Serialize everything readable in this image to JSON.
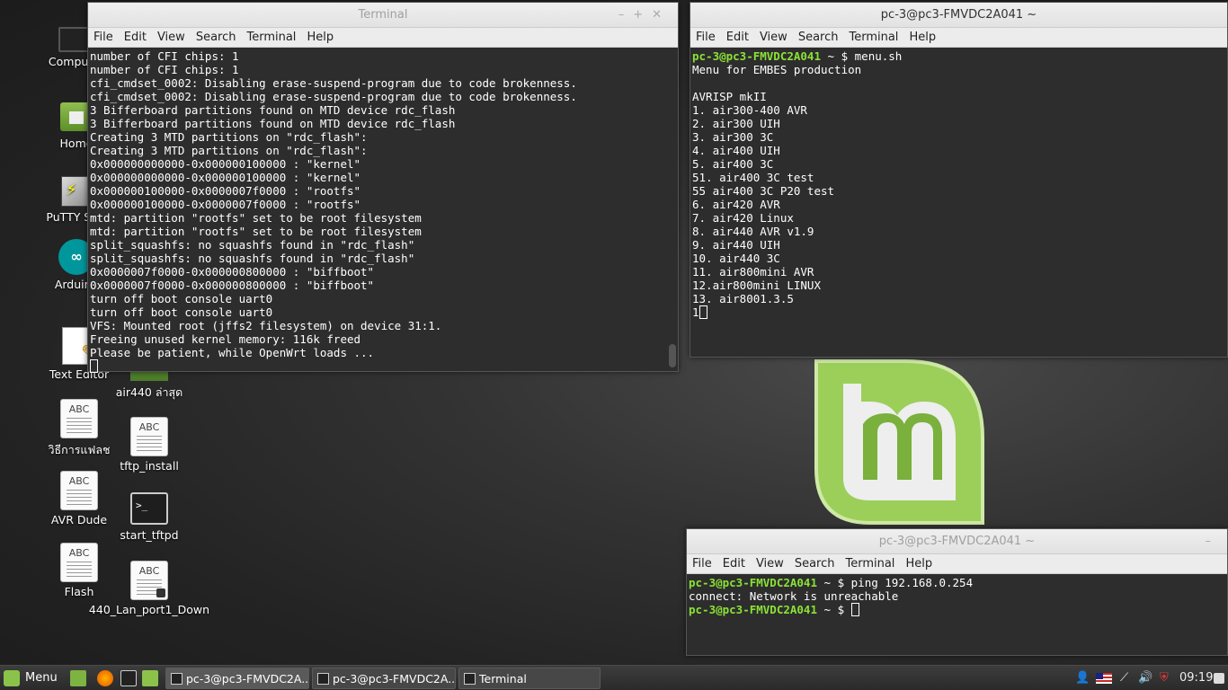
{
  "desktop": {
    "icons": [
      {
        "name": "computer",
        "label": "Computer"
      },
      {
        "name": "home",
        "label": "Home"
      },
      {
        "name": "putty",
        "label": "PuTTY SSH"
      },
      {
        "name": "arduino",
        "label": "Arduino"
      },
      {
        "name": "text-editor",
        "label": "Text Editor"
      },
      {
        "name": "air440",
        "label": "air440 ล่าสุด"
      },
      {
        "name": "flash-howto",
        "label": "วิธีการแฟลช"
      },
      {
        "name": "tftp-install",
        "label": "tftp_install"
      },
      {
        "name": "avr-dude",
        "label": "AVR Dude"
      },
      {
        "name": "start-tftpd",
        "label": "start_tftpd"
      },
      {
        "name": "flash",
        "label": "Flash"
      },
      {
        "name": "lan-port",
        "label": "440_Lan_port1_Down"
      }
    ],
    "doc_badge": "ABC",
    "term_badge": ">_",
    "arduino_badge": "∞"
  },
  "menu_labels": {
    "file": "File",
    "edit": "Edit",
    "view": "View",
    "search": "Search",
    "terminal": "Terminal",
    "help": "Help"
  },
  "win1": {
    "title": "Terminal",
    "lines": [
      "number of CFI chips: 1",
      "number of CFI chips: 1",
      "cfi_cmdset_0002: Disabling erase-suspend-program due to code brokenness.",
      "cfi_cmdset_0002: Disabling erase-suspend-program due to code brokenness.",
      "3 Bifferboard partitions found on MTD device rdc_flash",
      "3 Bifferboard partitions found on MTD device rdc_flash",
      "Creating 3 MTD partitions on \"rdc_flash\":",
      "Creating 3 MTD partitions on \"rdc_flash\":",
      "0x000000000000-0x000000100000 : \"kernel\"",
      "0x000000000000-0x000000100000 : \"kernel\"",
      "0x000000100000-0x0000007f0000 : \"rootfs\"",
      "0x000000100000-0x0000007f0000 : \"rootfs\"",
      "mtd: partition \"rootfs\" set to be root filesystem",
      "mtd: partition \"rootfs\" set to be root filesystem",
      "split_squashfs: no squashfs found in \"rdc_flash\"",
      "split_squashfs: no squashfs found in \"rdc_flash\"",
      "0x0000007f0000-0x000000800000 : \"biffboot\"",
      "0x0000007f0000-0x000000800000 : \"biffboot\"",
      "turn off boot console uart0",
      "turn off boot console uart0",
      "VFS: Mounted root (jffs2 filesystem) on device 31:1.",
      "Freeing unused kernel memory: 116k freed",
      "Please be patient, while OpenWrt loads ..."
    ]
  },
  "win2": {
    "title": "pc-3@pc3-FMVDC2A041 ~",
    "prompt": "pc-3@pc3-FMVDC2A041",
    "prompt_suffix": " ~ $ ",
    "command": "menu.sh",
    "lines": [
      "Menu for EMBES production",
      "",
      "AVRISP mkII",
      "1. air300-400 AVR",
      "2. air300 UIH",
      "3. air300 3C",
      "4. air400 UIH",
      "5. air400 3C",
      "51. air400 3C test",
      "55 air400 3C P20 test",
      "6. air420 AVR",
      "7. air420 Linux",
      "8. air440 AVR v1.9",
      "9. air440 UIH",
      "10. air440 3C",
      "11. air800mini AVR",
      "12.air800mini LINUX",
      "13. air8001.3.5"
    ],
    "input": "1"
  },
  "win3": {
    "title": "pc-3@pc3-FMVDC2A041 ~",
    "prompt": "pc-3@pc3-FMVDC2A041",
    "prompt_suffix": " ~ $ ",
    "command": "ping 192.168.0.254",
    "output": "connect: Network is unreachable"
  },
  "taskbar": {
    "menu_label": "Menu",
    "tasks": [
      "pc-3@pc3-FMVDC2A...",
      "pc-3@pc3-FMVDC2A...",
      "Terminal"
    ],
    "clock": "09:19"
  }
}
